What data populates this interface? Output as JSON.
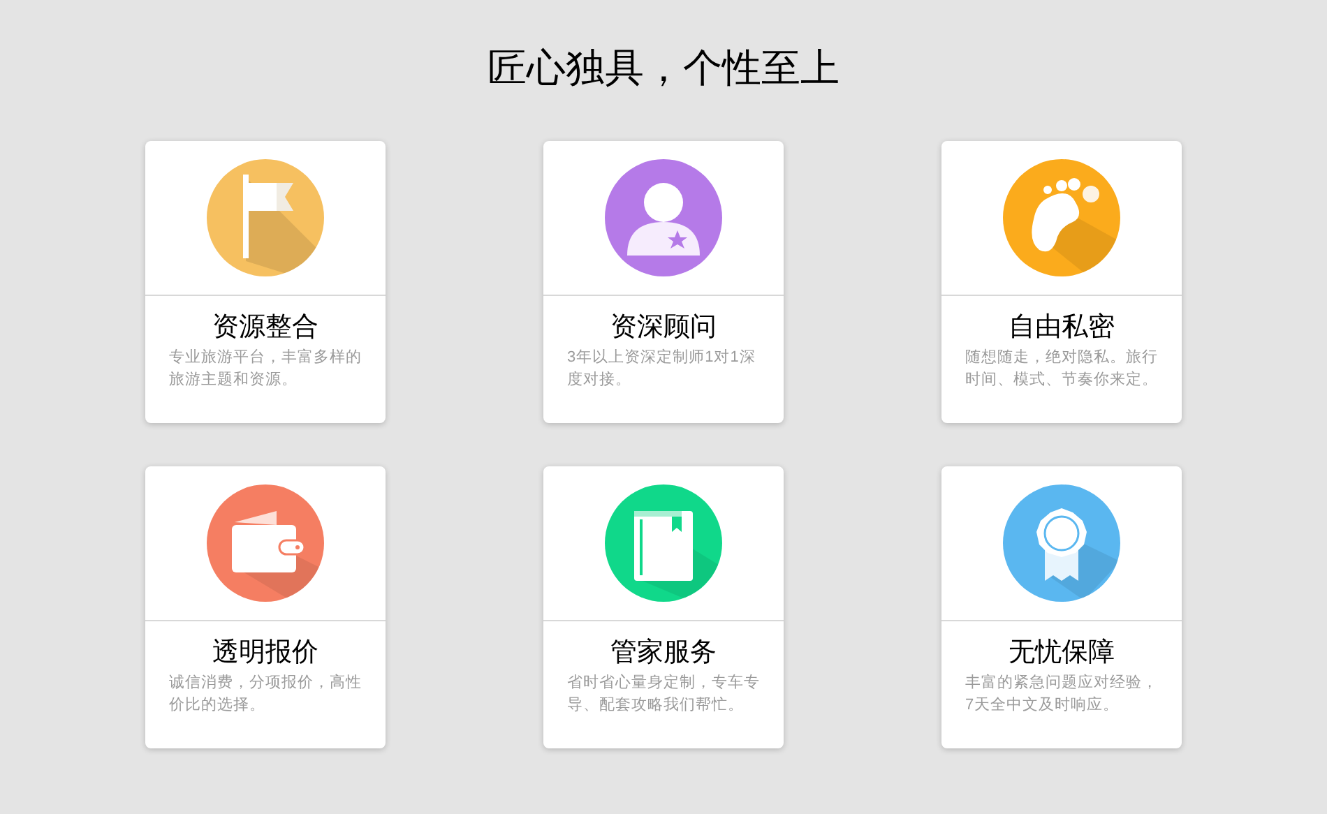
{
  "heading": "匠心独具，个性至上",
  "cards": [
    {
      "kind": "flag",
      "color": "#f6c060",
      "title": "资源整合",
      "description": "专业旅游平台，丰富多样的旅游主题和资源。"
    },
    {
      "kind": "person",
      "color": "#b57ae8",
      "title": "资深顾问",
      "description": "3年以上资深定制师1对1深度对接。"
    },
    {
      "kind": "footprint",
      "color": "#fbab1c",
      "title": "自由私密",
      "description": "随想随走，绝对隐私。旅行时间、模式、节奏你来定。"
    },
    {
      "kind": "wallet",
      "color": "#f57e62",
      "title": "透明报价",
      "description": "诚信消费，分项报价，高性价比的选择。"
    },
    {
      "kind": "book",
      "color": "#10d88a",
      "title": "管家服务",
      "description": "省时省心量身定制，专车专导、配套攻略我们帮忙。"
    },
    {
      "kind": "badge",
      "color": "#5ab7f0",
      "title": "无忧保障",
      "description": "丰富的紧急问题应对经验，7天全中文及时响应。"
    }
  ]
}
